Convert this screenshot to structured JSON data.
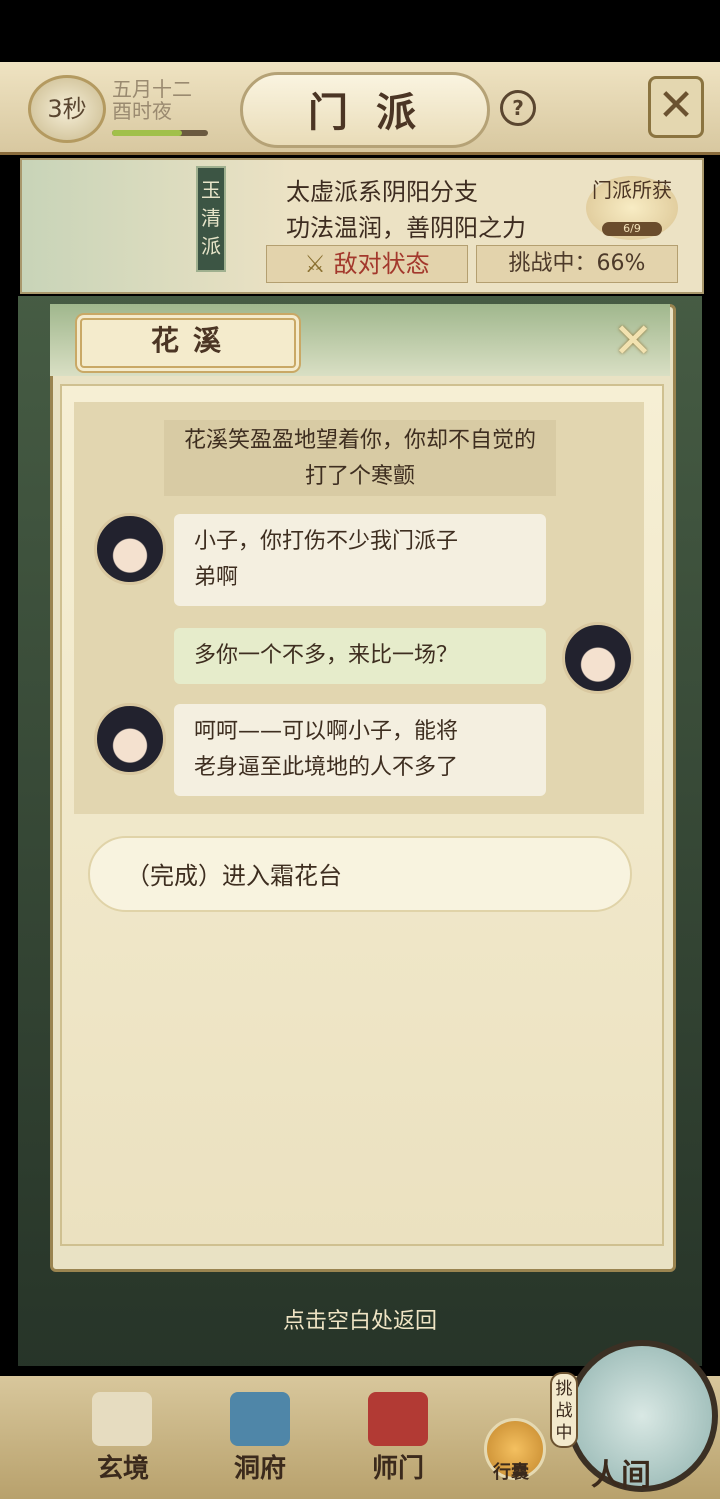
{
  "header": {
    "timer": "3秒",
    "date_line1": "五月十二",
    "date_line2": "酉时夜",
    "title": "门派",
    "help_label": "?"
  },
  "sect": {
    "banner": "玉清派",
    "desc_line1": "太虚派系阴阳分支",
    "desc_line2": "功法温润，善阴阳之力",
    "enemy_status": "敌对状态",
    "challenge": "挑战中：66%",
    "loot_label": "门派所获",
    "loot_count": "6/9"
  },
  "dialog": {
    "name": "花溪",
    "narration": "花溪笑盈盈地望着你，你却不自觉的打了个寒颤",
    "messages": [
      {
        "speaker": "npc",
        "text_line1": "小子，你打伤不少我门派子",
        "text_line2": "弟啊"
      },
      {
        "speaker": "player",
        "text_line1": "多你一个不多，来比一场？"
      },
      {
        "speaker": "npc",
        "text_line1": "呵呵——可以啊小子，能将",
        "text_line2": "老身逼至此境地的人不多了"
      }
    ],
    "option": "（完成）进入霜花台"
  },
  "hint": "点击空白处返回",
  "nav": {
    "items": [
      "玄境",
      "洞府",
      "师门",
      "行囊",
      "人间"
    ],
    "challenge_tag": "挑战中"
  },
  "colors": {
    "accent_gold": "#c9a865",
    "enemy_red": "#a3382c",
    "panel_bg": "#f6efd4"
  }
}
